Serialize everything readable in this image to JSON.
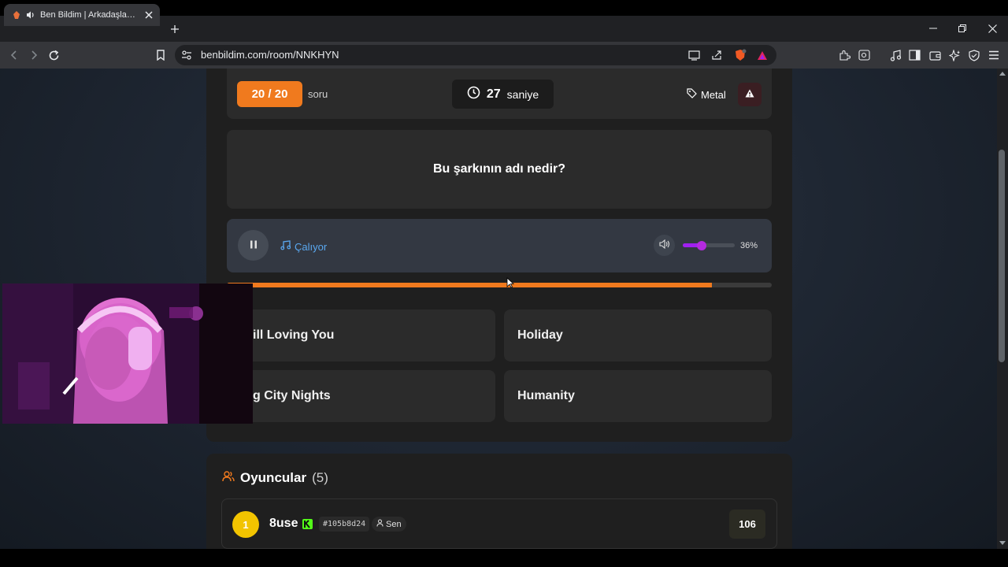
{
  "browser": {
    "tab_title": "Ben Bildim | Arkadaşlarınla Oyna",
    "url": "benbildim.com/room/NNKHYN"
  },
  "game": {
    "question_count": "20 / 20",
    "question_unit": "soru",
    "timer_value": "27",
    "timer_unit": "saniye",
    "genre": "Metal",
    "question_text": "Bu şarkının adı nedir?",
    "playback_status": "Çalıyor",
    "volume_percent": 36,
    "volume_label": "36%",
    "time_progress": 0.89,
    "answers": [
      "Still Loving You",
      "Holiday",
      "Big City Nights",
      "Humanity"
    ]
  },
  "players": {
    "title": "Oyuncular",
    "count": "(5)",
    "list": [
      {
        "rank": "1",
        "name": "8use",
        "id": "#105b8d24",
        "tag": "Sen",
        "score": "106"
      }
    ]
  },
  "colors": {
    "accent": "#f07a1e",
    "playing": "#5aa8f0",
    "volume": "#a020f0",
    "rank_gold": "#f2c400"
  }
}
